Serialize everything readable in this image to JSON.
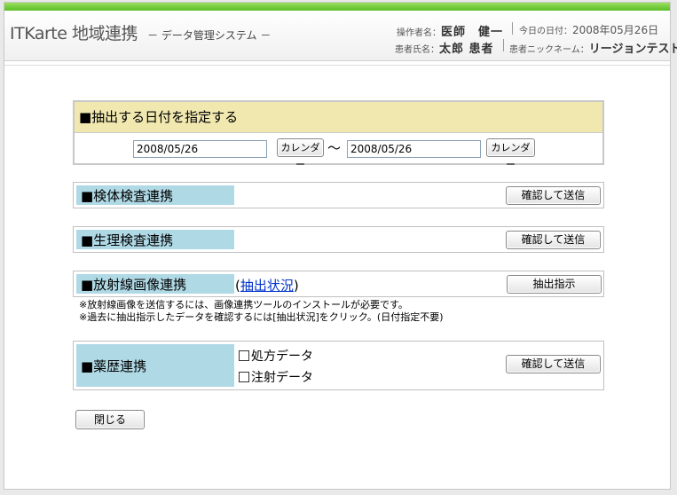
{
  "header": {
    "title": "ITKarte 地域連携",
    "subtitle": "－ データ管理システム －",
    "operator_label": "操作者名：",
    "operator_name": "医師　健一",
    "today_label": "今日の日付：",
    "today_value": "2008年05月26日",
    "patient_label": "患者氏名：",
    "patient_name": "太郎 患者",
    "nickname_label": "患者ニックネーム：",
    "nickname_value": "リージョンテスト"
  },
  "date_section": {
    "heading": "■抽出する日付を指定する",
    "from_value": "2008/05/26",
    "to_value": "2008/05/26",
    "calendar_label": "カレンダー",
    "separator": "～"
  },
  "sections": {
    "specimen": {
      "label": "■検体検査連携",
      "button": "確認して送信"
    },
    "physiology": {
      "label": "■生理検査連携",
      "button": "確認して送信"
    },
    "radiology": {
      "label": "■放射線画像連携",
      "paren_open": "(",
      "status_link": "抽出状況",
      "paren_close": ")",
      "button": "抽出指示"
    },
    "medication": {
      "label": "■薬歴連携",
      "options": [
        "処方データ",
        "注射データ"
      ],
      "button": "確認して送信"
    }
  },
  "notes": [
    "※放射線画像を送信するには、画像連携ツールのインストールが必要です。",
    "※過去に抽出指示したデータを確認するには[抽出状況]をクリック。(日付指定不要)"
  ],
  "close_button": "閉じる"
}
